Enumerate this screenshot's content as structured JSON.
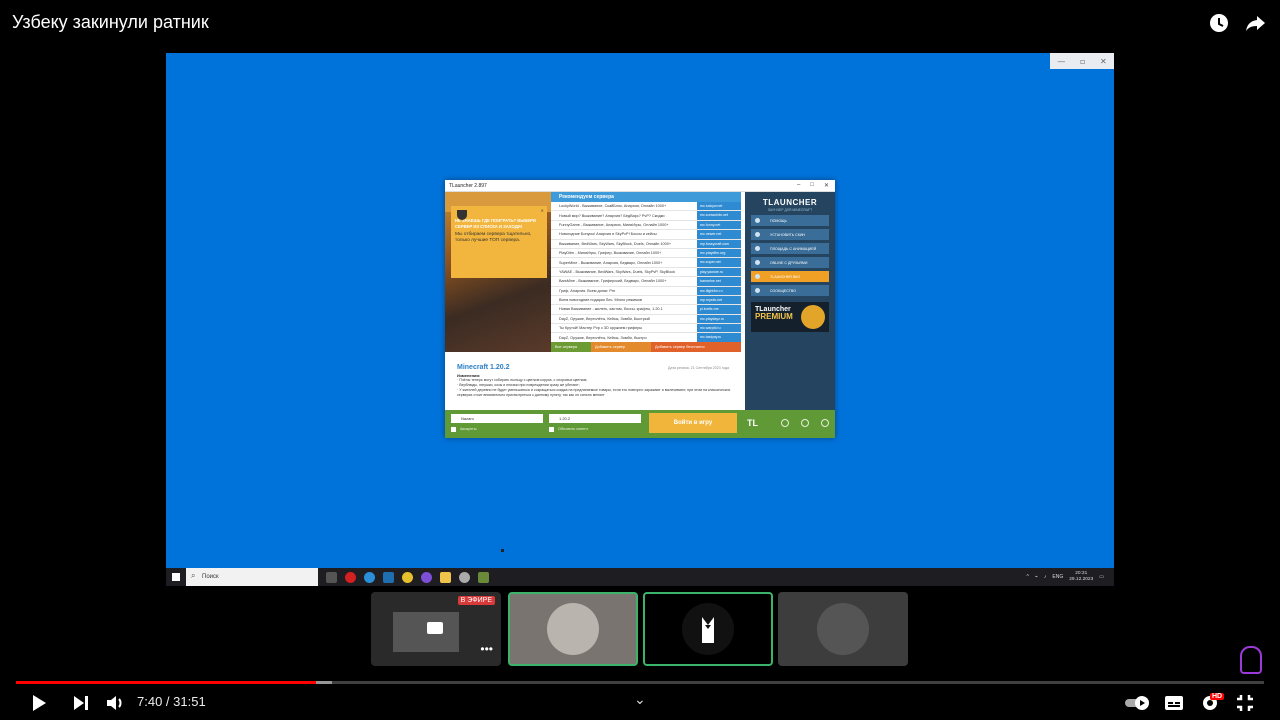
{
  "video": {
    "title": "Узбеку закинули ратник",
    "time_current": "7:40",
    "time_sep": " / ",
    "time_total": "31:51",
    "progress_fraction": 0.2407,
    "buffered_fraction": 0.253,
    "icons": [
      "watch-later-icon",
      "share-icon",
      "play-icon",
      "next-icon",
      "volume-icon",
      "chevron-down-icon",
      "autoplay-toggle-icon",
      "subtitles-icon",
      "settings-icon",
      "exit-fullscreen-icon"
    ],
    "hd_badge": "HD",
    "accent_color": "#ff0000"
  },
  "screen": {
    "desktop_color": "#0073db",
    "launcher": {
      "title": "TLauncher 2.897",
      "tip": {
        "headline": "НЕ ЗНАЕШЬ ГДЕ ПОИГРАТЬ? ВЫБЕРИ СЕРВЕР ИЗ СПИСКА И ЗАХОДИ!",
        "body": "Мы отбираем сервера тщательно, только лучшие ТОП сервера."
      },
      "servers_header": "Рекомендуем сервера",
      "servers": [
        {
          "name": "LuckyWorld - Выживание, СкайБлок, Анархия, Онлайн 1000+",
          "ip": "mc.luckyw.net"
        },
        {
          "name": "Новый мир? Выживание? Анархия? БедВарс? PvP? Скидки",
          "ip": "mc.sunworlds.net"
        },
        {
          "name": "FunnyGame - Выживание, Анархия, МиниИгры, Онлайн 1000+",
          "ip": "mc.funny.net"
        },
        {
          "name": "Новогодние Бонусы! Анархия и SkyPvP! Боссы и кейсы",
          "ip": "mc.newer.net"
        },
        {
          "name": "Выживание, BedWars, SkyWars, SkyBlock, Duels, Онлайн 1000+",
          "ip": "mp.fussycraft.com"
        },
        {
          "name": "PlayDitm - МиниИгры, Грифер, Выживание, Онлайн 1000+",
          "ip": "mc.playditm.org"
        },
        {
          "name": "SuperMine - Выживание, Анархия, Бедварс, Онлайн 1000+",
          "ip": "mc.super.net"
        },
        {
          "name": "YAWAE - Выживание, BedWars, SkyWars, Duels, SkyPvP, SkyBlock",
          "ip": "play.yaware.ru"
        },
        {
          "name": "BarsMine - Выживание, Гриферский, Бедварс, Онлайн 1000+",
          "ip": "barsmine.net"
        },
        {
          "name": "Гриф, Анархия. Всем донат. Рпг",
          "ip": "mc.ifight4m.ru"
        },
        {
          "name": "Всем новогодние подарки Лич. Много режимов",
          "ip": "mp.mystix.net"
        },
        {
          "name": "Новая Выживание - жилеть, кастом, боссы, крафты, 1.20.1",
          "ip": "pl.kraftx.me"
        },
        {
          "name": "DayZ, Оружие, Вертолёты, Кейсы, Зомби, Быстрый",
          "ip": "mc.playdayz.ru"
        },
        {
          "name": "Ты Крутой! Мастер Pvp с 3D оружием гриферы",
          "ip": "mc.warpbl.ru"
        },
        {
          "name": "DayZ, Оружие, Вертолёты, Кейсы, Зомби, быстро",
          "ip": "mc.tastpay.ru"
        }
      ],
      "server_tabs": [
        "Все сервера",
        "Добавить сервер",
        "Добавить сервер бесплатно"
      ],
      "brand": "TLAUNCHER",
      "brand_sub": "ЛАУНЧЕР ДЛЯ MINECRAFT",
      "side_buttons": [
        "ПОМОЩЬ",
        "УСТАНОВИТЬ СКИН",
        "ПЛОЩАДЬ С АНИМАЦИЕЙ",
        "ONLINE С ДРУЗЬЯМИ",
        "TLAUNCHER ВКО",
        "СООБЩЕСТВО"
      ],
      "premium_line1": "TLauncher",
      "premium_line2": "PREMIUM",
      "news": {
        "version": "Minecraft 1.20.2",
        "date": "Дата релиза: 21 Сентября 2023 года",
        "caption": "Изменения:",
        "lines": [
          "· Пчёлы теперь могут собирать пыльцу с цветков корусa, с споровых цветков;",
          "· Верблюды, лягушки, козы и нюхачи при повреждении сразу же убегают;",
          "· У жителей деревни не будет уменьшаться и сокращаться скидка на предлагаемые товары, если его повторно заражают и вылечивают; при этом на классических серверах стоит внимательно присмотреться к данному пункту, так как он сильно меняет"
        ]
      },
      "account_select": "Nazaro",
      "version_select": "1.20.2",
      "accounts_check": "Аккаунты",
      "update_check": "Обновить клиент",
      "play_button": "Войти в игру",
      "tl_mark": "TL"
    },
    "taskbar": {
      "search_placeholder": "Поиск",
      "lang": "ENG",
      "time": "20:31",
      "date": "29.12.2023"
    }
  },
  "participants": {
    "live_badge": "В ЭФИРЕ",
    "more": "•••"
  }
}
